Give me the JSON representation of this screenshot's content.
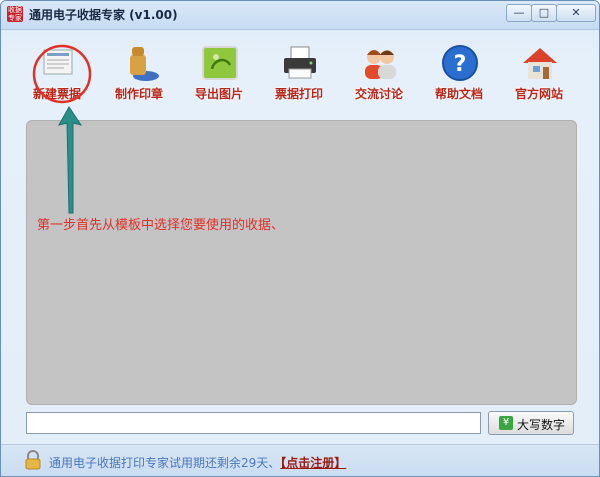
{
  "window": {
    "title": "通用电子收据专家 (v1.00)",
    "app_icon_text": [
      "收据",
      "专家"
    ],
    "minimize_glyph": "—",
    "maximize_glyph": "□",
    "close_glyph": "✕"
  },
  "toolbar": {
    "items": [
      {
        "label": "新建票据",
        "icon": "new-receipt-icon"
      },
      {
        "label": "制作印章",
        "icon": "stamp-icon"
      },
      {
        "label": "导出图片",
        "icon": "export-image-icon"
      },
      {
        "label": "票据打印",
        "icon": "printer-icon"
      },
      {
        "label": "交流讨论",
        "icon": "discussion-icon"
      },
      {
        "label": "帮助文档",
        "icon": "help-icon"
      },
      {
        "label": "官方网站",
        "icon": "home-icon"
      }
    ]
  },
  "canvas": {
    "annotation": "第一步首先从模板中选择您要使用的收据、"
  },
  "amount": {
    "input_value": "",
    "uppercase_button": "大写数字",
    "button_icon": "¥"
  },
  "status": {
    "trial_text": "通用电子收据打印专家试用期还剩余29天、",
    "register_link": "【点击注册】"
  },
  "colors": {
    "label_red": "#b8271a",
    "annotation_red": "#e0302a",
    "arrow_teal": "#2a8f88",
    "canvas_gray": "#c4c4c4"
  }
}
